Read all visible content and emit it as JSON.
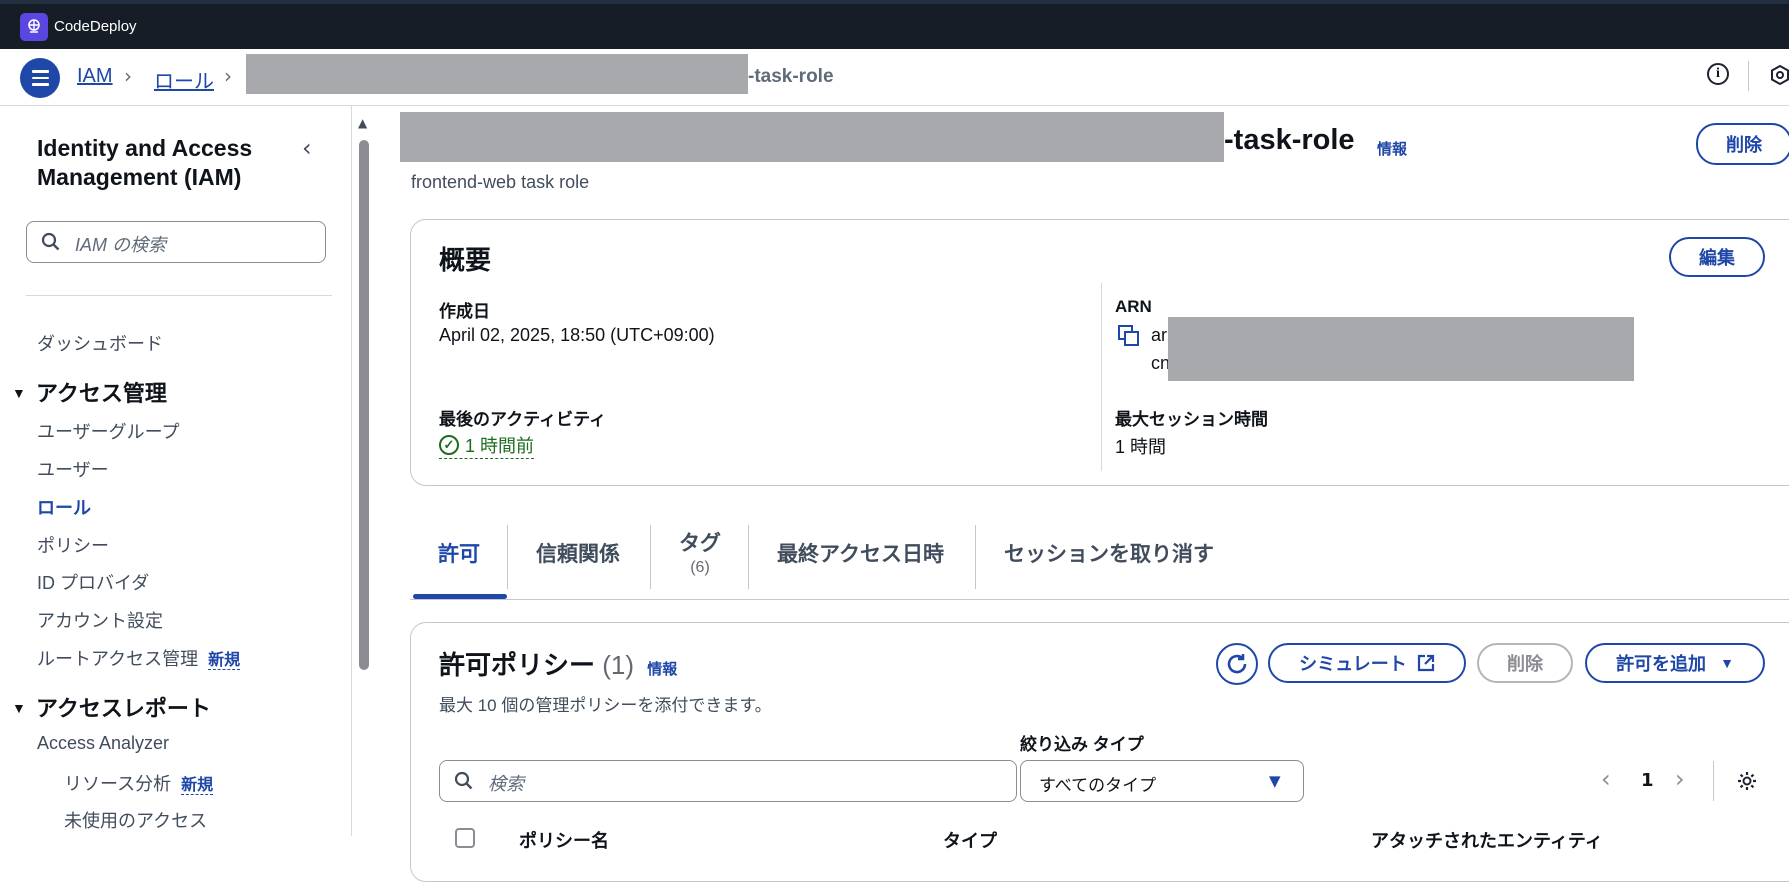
{
  "app": {
    "name": "CodeDeploy"
  },
  "breadcrumb": {
    "items": [
      "IAM",
      "ロール"
    ],
    "current_suffix": "-task-role"
  },
  "sidebar": {
    "title": "Identity and Access Management (IAM)",
    "search_placeholder": "IAM の検索",
    "dashboard": "ダッシュボード",
    "section_access_mgmt": "アクセス管理",
    "access_items": [
      "ユーザーグループ",
      "ユーザー",
      "ロール",
      "ポリシー",
      "ID プロバイダ",
      "アカウント設定",
      "ルートアクセス管理"
    ],
    "new_badge": "新規",
    "section_access_reports": "アクセスレポート",
    "report_items": [
      "Access Analyzer",
      "リソース分析",
      "未使用のアクセス"
    ]
  },
  "role": {
    "title_suffix": "-task-role",
    "info": "情報",
    "description": "frontend-web task role",
    "delete_button": "削除"
  },
  "summary": {
    "heading": "概要",
    "edit_button": "編集",
    "created_label": "作成日",
    "created_value": "April 02, 2025, 18:50 (UTC+09:00)",
    "activity_label": "最後のアクティビティ",
    "activity_value": "1 時間前",
    "arn_label": "ARN",
    "arn_line1": "ar",
    "arn_line2": "cn",
    "session_label": "最大セッション時間",
    "session_value": "1 時間"
  },
  "tabs": [
    {
      "label": "許可"
    },
    {
      "label": "信頼関係"
    },
    {
      "label": "タグ",
      "count": "(6)"
    },
    {
      "label": "最終アクセス日時"
    },
    {
      "label": "セッションを取り消す"
    }
  ],
  "permissions": {
    "heading": "許可ポリシー",
    "count": "(1)",
    "info": "情報",
    "subtitle": "最大 10 個の管理ポリシーを添付できます。",
    "simulate_button": "シミュレート",
    "delete_button": "削除",
    "add_button": "許可を追加",
    "search_placeholder": "検索",
    "filter_label": "絞り込み タイプ",
    "filter_value": "すべてのタイプ",
    "page_number": "1",
    "columns": [
      "ポリシー名",
      "タイプ",
      "アタッチされたエンティティ"
    ]
  },
  "colors": {
    "accent": "#1f47a8",
    "topbar": "#161d26",
    "success": "#1f6b20"
  }
}
